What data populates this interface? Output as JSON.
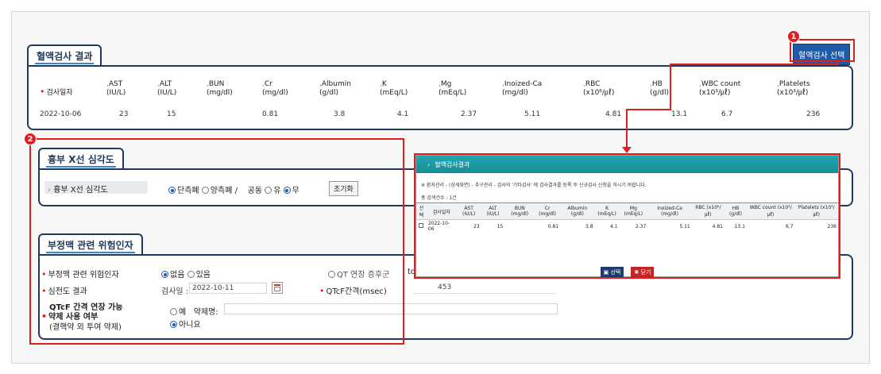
{
  "blood_test": {
    "title": "혈액검사 결과",
    "select_button": "혈액검사 선택",
    "headers": [
      {
        "label": "검사일자",
        "unit": ""
      },
      {
        "label": "AST",
        "unit": "(IU/L)"
      },
      {
        "label": "ALT",
        "unit": "(IU/L)"
      },
      {
        "label": "BUN",
        "unit": "(mg/dl)"
      },
      {
        "label": "Cr",
        "unit": "(mg/dl)"
      },
      {
        "label": "Albumin",
        "unit": "(g/dl)"
      },
      {
        "label": "K",
        "unit": "(mEq/L)"
      },
      {
        "label": "Mg",
        "unit": "(mEq/L)"
      },
      {
        "label": "Inoized-Ca",
        "unit": "(mg/dl)"
      },
      {
        "label": "RBC",
        "unit": "(x10⁶/㎕)"
      },
      {
        "label": "HB",
        "unit": "(g/dl)"
      },
      {
        "label": "WBC count",
        "unit": "(x10³/㎕)"
      },
      {
        "label": "Platelets",
        "unit": "(x10³/㎕)"
      }
    ],
    "row": [
      "2022-10-06",
      "23",
      "15",
      "",
      "0.81",
      "3.8",
      "4.1",
      "2.37",
      "5.11",
      "4.81",
      "13.1",
      "6.7",
      "236"
    ]
  },
  "xray": {
    "title": "흉부 X선 심각도",
    "label": "흉부 X선 심각도",
    "opt1": "단측폐",
    "opt2": "양측폐 /",
    "cavity": "공동",
    "yes": "유",
    "no": "무",
    "reset": "초기화"
  },
  "arrhythmia": {
    "title": "부정맥 관련 위험인자",
    "risk_label": "부정맥 관련 위험인자",
    "risk_no": "없음",
    "risk_yes": "있음",
    "qt_label": "QT 연장 증후군",
    "qt_to": "to",
    "ecg_label": "심전도 결과",
    "exam_date_label": "검사일 :",
    "exam_date": "2022-10-11",
    "qtcf_label": "QTcF간격(msec)",
    "qtcf_value": "453",
    "drug_label1": "QTcF 간격 연장 가능",
    "drug_label2": "약제 사용 여부",
    "drug_label3": "(결핵약 외 투여 약제)",
    "drug_yes": "예",
    "drug_name_label": "약제명:",
    "drug_no": "아니요"
  },
  "popup": {
    "title": "혈액검사결과",
    "notice": "※ 환자관리 - (상세화면) - 추구관리 - 검사의 '기타검사' 에 검사결과를 등록 후 신규검사 신청을 하시기 바랍니다.",
    "count": "총 검색건수 : 1건",
    "headers": [
      "선택",
      "검사일자",
      "AST (IU/L)",
      "ALT (IU/L)",
      "BUN (mg/dl)",
      "Cr (mg/dl)",
      "Albumin (g/dl)",
      "K (mEq/L)",
      "Mg (mEq/L)",
      "Inoized-Ca (mg/dl)",
      "RBC (x10⁶/㎕)",
      "HB (g/dl)",
      "WBC count (x10³/㎕)",
      "Platelets (x10³/㎕)"
    ],
    "row": [
      "",
      "2022-10-06",
      "23",
      "15",
      "",
      "0.81",
      "3.8",
      "4.1",
      "2.37",
      "5.11",
      "4.81",
      "13.1",
      "6.7",
      "236"
    ],
    "select_btn": "선택",
    "close_btn": "닫기"
  },
  "badges": {
    "one": "1",
    "two": "2"
  },
  "colors": {
    "navy": "#1f3a5c",
    "red": "#e01e1e",
    "teal": "#1a9aa3",
    "blue_btn": "#1e5aa8"
  }
}
